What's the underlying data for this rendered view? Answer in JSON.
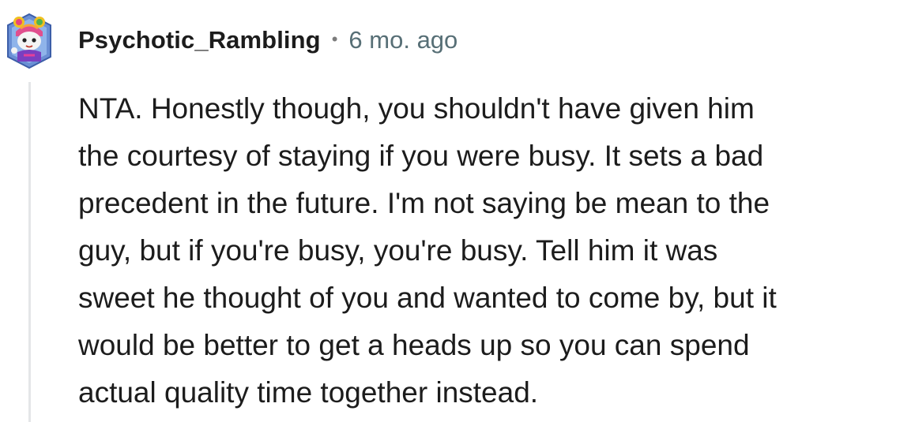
{
  "comment": {
    "author": "Psychotic_Rambling",
    "separator": "•",
    "timestamp": "6 mo. ago",
    "avatar_icon": "snoo-avatar-icon",
    "body_lines": [
      "NTA. Honestly though, you shouldn't have given him",
      "the courtesy of staying if you were busy. It sets a bad",
      "precedent in the future. I'm not saying be mean to the",
      "guy, but if you're busy, you're busy. Tell him it was",
      "sweet he thought of you and wanted to come by, but it",
      "would be better to get a heads up so you can spend",
      "actual quality time together instead."
    ]
  },
  "colors": {
    "username": "#1c1c1c",
    "timestamp": "#576f76",
    "thread_line": "#e4e6e8",
    "avatar_bg": "#5b8fd8"
  }
}
